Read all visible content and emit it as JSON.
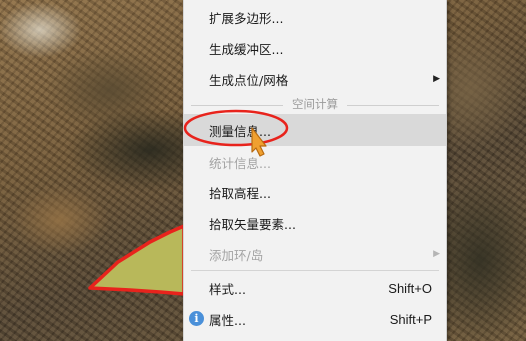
{
  "menu": {
    "items": [
      {
        "label": "扩展多边形...",
        "disabled": false,
        "submenu": false,
        "shortcut": ""
      },
      {
        "label": "生成缓冲区...",
        "disabled": false,
        "submenu": false,
        "shortcut": ""
      },
      {
        "label": "生成点位/网格",
        "disabled": false,
        "submenu": true,
        "shortcut": ""
      },
      {
        "label": "测量信息...",
        "disabled": false,
        "submenu": false,
        "shortcut": "",
        "highlighted": true
      },
      {
        "label": "统计信息...",
        "disabled": true,
        "submenu": false,
        "shortcut": ""
      },
      {
        "label": "拾取高程...",
        "disabled": false,
        "submenu": false,
        "shortcut": ""
      },
      {
        "label": "拾取矢量要素...",
        "disabled": false,
        "submenu": false,
        "shortcut": ""
      },
      {
        "label": "添加环/岛",
        "disabled": true,
        "submenu": true,
        "shortcut": ""
      },
      {
        "label": "样式...",
        "disabled": false,
        "submenu": false,
        "shortcut": "Shift+O"
      },
      {
        "label": "属性...",
        "disabled": false,
        "submenu": false,
        "shortcut": "Shift+P",
        "icon": "info-icon"
      }
    ],
    "section_title": "空间计算",
    "submenu_arrow": "▶"
  },
  "colors": {
    "polygon_fill": "#b8b85a",
    "polygon_stroke": "#e8231c",
    "annotation": "#e8231c",
    "cursor": "#f0a030"
  }
}
